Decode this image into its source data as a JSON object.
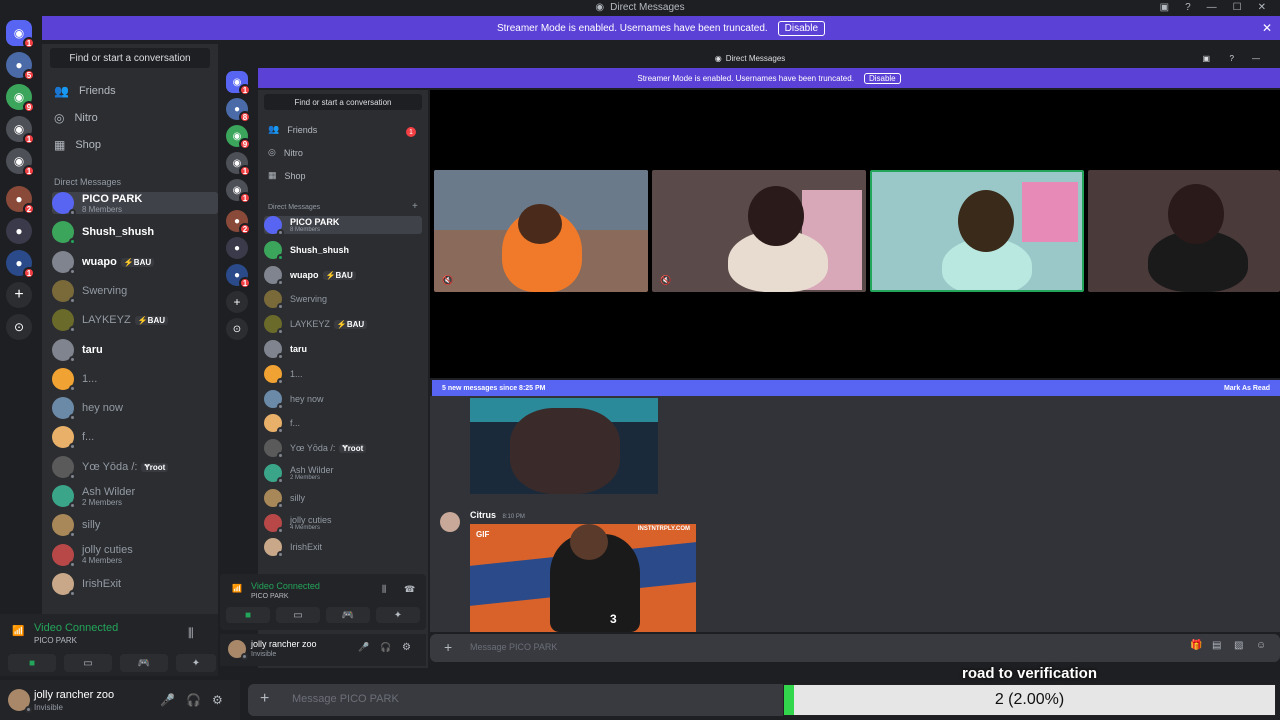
{
  "window": {
    "title": "Direct Messages",
    "controls": [
      "—",
      "☐",
      "✕"
    ]
  },
  "banner": {
    "text": "Streamer Mode is enabled. Usernames have been truncated.",
    "button": "Disable"
  },
  "inner_window": {
    "title": "Direct Messages"
  },
  "search": {
    "placeholder": "Find or start a conversation"
  },
  "nav": {
    "friends": "Friends",
    "friends_badge": "1",
    "nitro": "Nitro",
    "shop": "Shop"
  },
  "dm_header": "Direct Messages",
  "servers": [
    {
      "badge": "1"
    },
    {
      "badge": "5"
    },
    {
      "badge": "9"
    },
    {
      "badge": "1"
    },
    {
      "badge": "1"
    },
    {
      "badge": "2"
    },
    {
      "badge": ""
    },
    {
      "badge": "1"
    }
  ],
  "inner_servers": [
    {
      "badge": "1"
    },
    {
      "badge": "8"
    },
    {
      "badge": "9"
    },
    {
      "badge": "1"
    },
    {
      "badge": "1"
    },
    {
      "badge": "2"
    },
    {
      "badge": ""
    },
    {
      "badge": "1"
    }
  ],
  "dms": [
    {
      "name": "PICO PARK",
      "sub": "8 Members",
      "bold": true,
      "color": "#5865f2"
    },
    {
      "name": "Shush_shush",
      "sub": "",
      "bold": true,
      "color": "#3ba55c"
    },
    {
      "name": "wuapo",
      "sub": "",
      "tag": "⚡BAU",
      "bold": true,
      "color": "#80848e"
    },
    {
      "name": "Swerving",
      "sub": "",
      "color": "#7a6a3a"
    },
    {
      "name": "LAYKEYZ",
      "sub": "",
      "tag": "⚡BAU",
      "color": "#6a6a2a"
    },
    {
      "name": "taru",
      "sub": "",
      "bold": true,
      "color": "#80848e"
    },
    {
      "name": "1...",
      "sub": "",
      "color": "#f0a232"
    },
    {
      "name": "hey now",
      "sub": "",
      "color": "#6b8aa8"
    },
    {
      "name": "f...",
      "sub": "",
      "color": "#e8b068"
    },
    {
      "name": "Yœ Yōda /:",
      "sub": "",
      "tag": "Ɏroot",
      "color": "#5a5a5a"
    },
    {
      "name": "Ash Wilder",
      "sub": "2 Members",
      "color": "#3ba58a"
    },
    {
      "name": "silly",
      "sub": "",
      "color": "#a88858"
    },
    {
      "name": "jolly cuties",
      "sub": "4 Members",
      "color": "#b84848"
    },
    {
      "name": "IrishExit",
      "sub": "",
      "color": "#c8a888"
    }
  ],
  "voice": {
    "status": "Video Connected",
    "channel": "PICO PARK"
  },
  "user": {
    "name": "jolly rancher zoo",
    "status": "Invisible"
  },
  "new_messages": {
    "text": "5 new messages since 8:25 PM",
    "action": "Mark As Read"
  },
  "message": {
    "author": "Citrus",
    "time": "8:10 PM",
    "gif_label": "GIF",
    "gif_watermark": "INSTNTRPLY.COM",
    "jersey_number": "3"
  },
  "composer": {
    "placeholder": "Message PICO PARK"
  },
  "overlay": {
    "title": "road to verification",
    "progress_text": "2 (2.00%)",
    "progress": 0.02
  },
  "colors": {
    "accent": "#5865f2",
    "banner": "#5c41d6",
    "online": "#23a55a",
    "progress": "#32d74b"
  }
}
